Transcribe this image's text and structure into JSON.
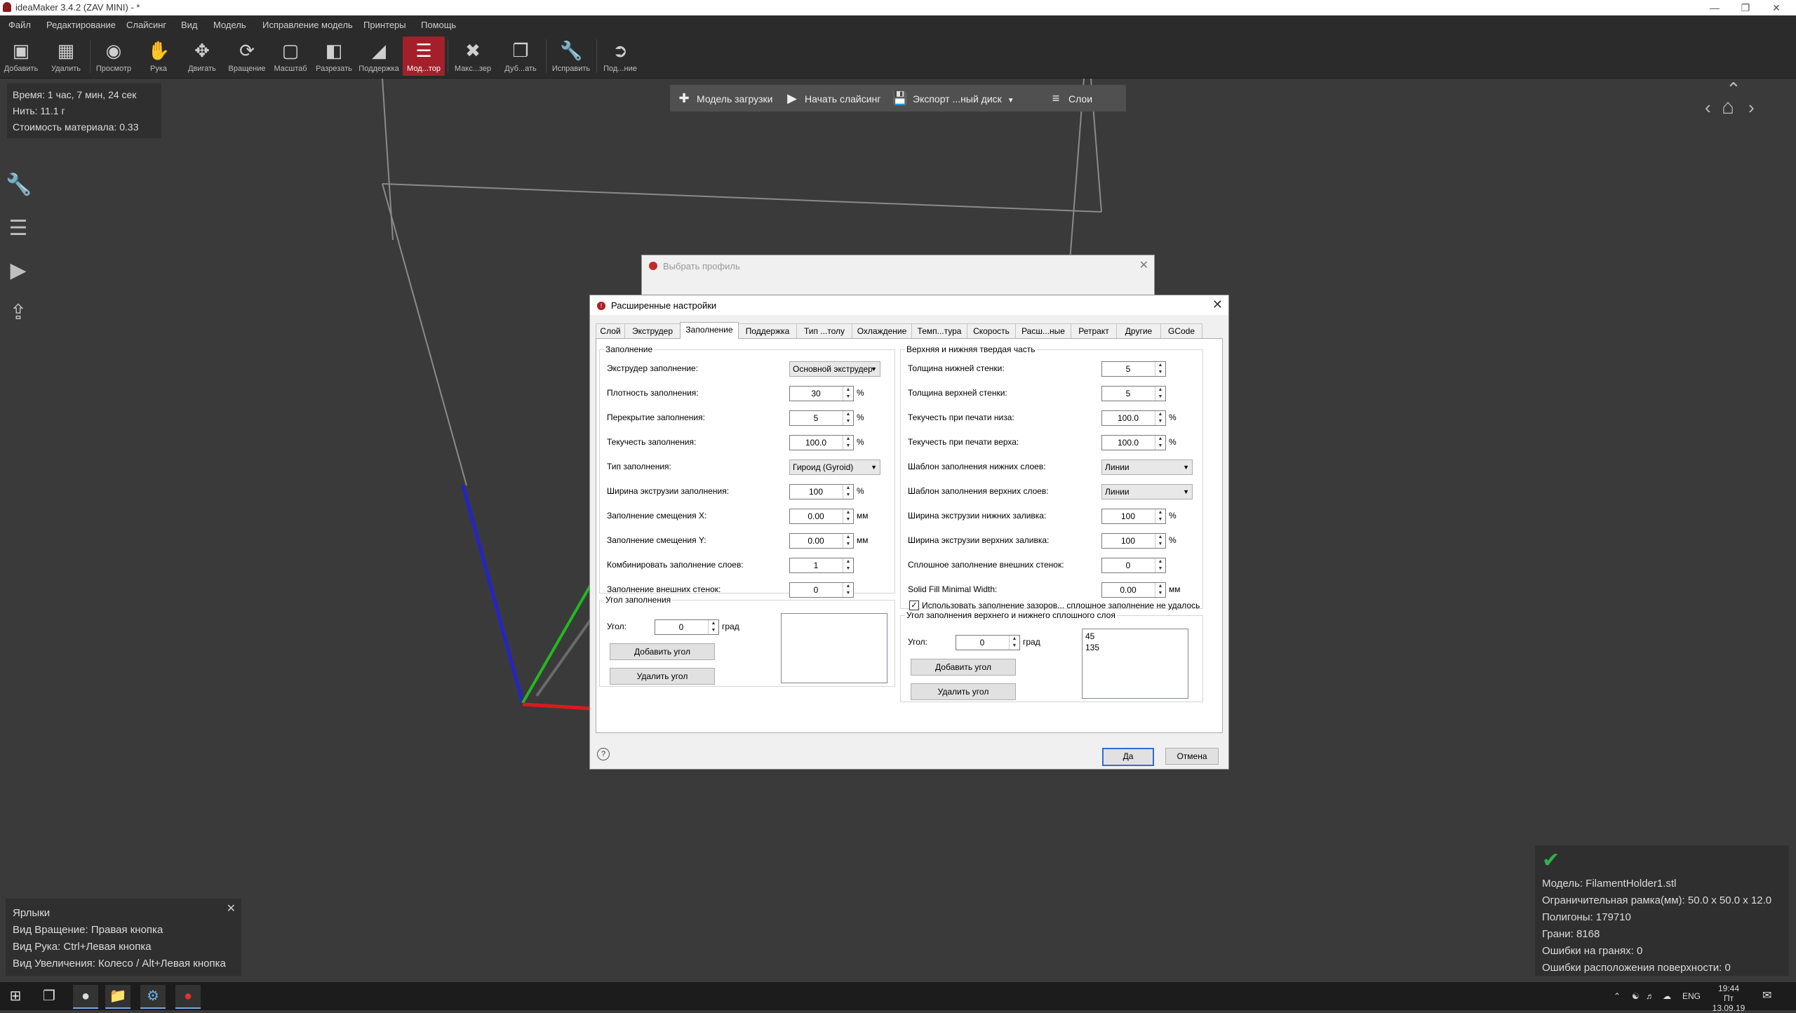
{
  "window": {
    "title": "ideaMaker 3.4.2 (ZAV MINI) - *"
  },
  "menu": [
    "Файл",
    "Редактирование",
    "Слайсинг",
    "Вид",
    "Модель",
    "Исправление модель",
    "Принтеры",
    "Помощь"
  ],
  "toolbar": [
    {
      "label": "Добавить",
      "icon": "add-cube-icon"
    },
    {
      "label": "Удалить",
      "icon": "remove-cube-icon"
    },
    {
      "label": "Просмотр",
      "icon": "eye-icon"
    },
    {
      "label": "Рука",
      "icon": "hand-icon"
    },
    {
      "label": "Двигать",
      "icon": "move-icon"
    },
    {
      "label": "Вращение",
      "icon": "rotate-icon"
    },
    {
      "label": "Масштаб",
      "icon": "scale-icon"
    },
    {
      "label": "Разрезать",
      "icon": "cut-icon"
    },
    {
      "label": "Поддержка",
      "icon": "support-icon"
    },
    {
      "label": "Мод...тор",
      "icon": "modifier-icon"
    },
    {
      "label": "Макс...зер",
      "icon": "maximize-icon"
    },
    {
      "label": "Дуб...ать",
      "icon": "duplicate-icon"
    },
    {
      "label": "Исправить",
      "icon": "wrench-icon"
    },
    {
      "label": "Под...ние",
      "icon": "connect-icon"
    }
  ],
  "info": {
    "time": "Время: 1 час, 7 мин, 24 сек",
    "filament": "Нить: 11.1 г",
    "cost": "Стоимость материала: 0.33"
  },
  "actionbar": {
    "load": "Модель загрузки",
    "slice": "Начать слайсинг",
    "export": "Экспорт ...ный диск",
    "layers": "Слои"
  },
  "bg_dialog": {
    "title": "Выбрать профиль"
  },
  "dialog": {
    "title": "Расширенные настройки",
    "tabs": [
      "Слой",
      "Экструдер",
      "Заполнение",
      "Поддержка",
      "Тип ...толу",
      "Охлаждение",
      "Темп...тура",
      "Скорость",
      "Расш...ные",
      "Ретракт",
      "Другие",
      "GCode"
    ],
    "infill": {
      "group_title": "Заполнение",
      "rows": [
        {
          "label": "Экструдер заполнение:",
          "kind": "combo",
          "value": "Основной экструдер",
          "unit": ""
        },
        {
          "label": "Плотность заполнения:",
          "kind": "spin",
          "value": "30",
          "unit": "%"
        },
        {
          "label": "Перекрытие заполнения:",
          "kind": "spin",
          "value": "5",
          "unit": "%"
        },
        {
          "label": "Текучесть заполнения:",
          "kind": "spin",
          "value": "100.0",
          "unit": "%"
        },
        {
          "label": "Тип заполнения:",
          "kind": "combo",
          "value": "Гироид (Gyroid)",
          "unit": ""
        },
        {
          "label": "Ширина экструзии заполнения:",
          "kind": "spin",
          "value": "100",
          "unit": "%"
        },
        {
          "label": "Заполнение смещения X:",
          "kind": "spin",
          "value": "0.00",
          "unit": "мм"
        },
        {
          "label": "Заполнение смещения Y:",
          "kind": "spin",
          "value": "0.00",
          "unit": "мм"
        },
        {
          "label": "Комбинировать заполнение слоев:",
          "kind": "spin",
          "value": "1",
          "unit": ""
        },
        {
          "label": "Заполнение внешних стенок:",
          "kind": "spin",
          "value": "0",
          "unit": ""
        }
      ]
    },
    "infill_angle": {
      "group_title": "Угол заполнения",
      "angle_label": "Угол:",
      "angle_value": "0",
      "angle_unit": "град",
      "add": "Добавить угол",
      "remove": "Удалить угол"
    },
    "solid": {
      "group_title": "Верхняя и нижняя твердая часть",
      "rows": [
        {
          "label": "Толщина нижней стенки:",
          "kind": "spin",
          "value": "5",
          "unit": ""
        },
        {
          "label": "Толщина верхней стенки:",
          "kind": "spin",
          "value": "5",
          "unit": ""
        },
        {
          "label": "Текучесть при печати низа:",
          "kind": "spin",
          "value": "100.0",
          "unit": "%"
        },
        {
          "label": "Текучесть при печати верха:",
          "kind": "spin",
          "value": "100.0",
          "unit": "%"
        },
        {
          "label": "Шаблон заполнения нижних слоев:",
          "kind": "combo",
          "value": "Линии",
          "unit": ""
        },
        {
          "label": "Шаблон заполнения верхних слоев:",
          "kind": "combo",
          "value": "Линии",
          "unit": ""
        },
        {
          "label": "Ширина экструзии нижних заливка:",
          "kind": "spin",
          "value": "100",
          "unit": "%"
        },
        {
          "label": "Ширина экструзии верхних заливка:",
          "kind": "spin",
          "value": "100",
          "unit": "%"
        },
        {
          "label": "Сплошное заполнение внешних стенок:",
          "kind": "spin",
          "value": "0",
          "unit": ""
        },
        {
          "label": "Solid Fill Minimal Width:",
          "kind": "spin",
          "value": "0.00",
          "unit": "мм"
        }
      ],
      "checkbox_label": "Использовать заполнение зазоров... сплошное заполнение не удалось"
    },
    "solid_angle": {
      "group_title": "Угол заполнения верхнего и нижнего сплошного слоя",
      "angle_label": "Угол:",
      "angle_value": "0",
      "angle_unit": "град",
      "add": "Добавить угол",
      "remove": "Удалить угол",
      "list": [
        "45",
        "135"
      ]
    },
    "ok": "Да",
    "cancel": "Отмена"
  },
  "shortcuts": {
    "title": "Ярлыки",
    "lines": [
      "Вид Вращение: Правая кнопка",
      "Вид Рука: Ctrl+Левая кнопка",
      "Вид Увеличения: Колесо / Alt+Левая кнопка"
    ]
  },
  "model_info": {
    "lines": [
      "Модель: FilamentHolder1.stl",
      "Ограничительная рамка(мм): 50.0 x 50.0 x 12.0",
      "Полигоны: 179710",
      "Грани: 8168",
      "Ошибки на гранях: 0",
      "Ошибки расположения поверхности: 0"
    ]
  },
  "taskbar": {
    "lang": "ENG",
    "time": "19:44",
    "date": "Пт 13.09.19"
  }
}
